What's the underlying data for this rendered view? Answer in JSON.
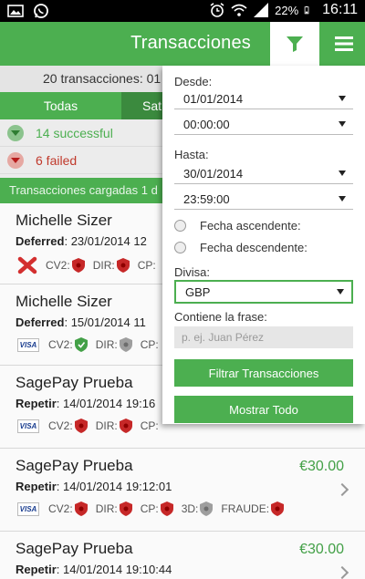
{
  "status_bar": {
    "battery": "22%",
    "time": "16:11"
  },
  "action_bar": {
    "title": "Transacciones"
  },
  "list": {
    "count_text": "20 transacciones: 01",
    "tabs": [
      "Todas",
      "Sat"
    ],
    "successful": "14 successful",
    "failed": "6 failed",
    "loaded_text": "Transacciones cargadas 1 d",
    "transactions": [
      {
        "name": "Michelle Sizer",
        "status": "Deferred",
        "date": "23/01/2014 12",
        "amount": "",
        "card": "redx",
        "checks": [
          {
            "label": "CV2:",
            "state": "fail"
          },
          {
            "label": "DIR:",
            "state": "fail"
          },
          {
            "label": "CP:",
            "state": "fail"
          }
        ]
      },
      {
        "name": "Michelle Sizer",
        "status": "Deferred",
        "date": "15/01/2014 11",
        "amount": "",
        "card": "VISA",
        "checks": [
          {
            "label": "CV2:",
            "state": "pass"
          },
          {
            "label": "DIR:",
            "state": "na"
          },
          {
            "label": "CP:",
            "state": "na"
          }
        ]
      },
      {
        "name": "SagePay Prueba",
        "status": "Repetir",
        "date": "14/01/2014 19:16",
        "amount": "",
        "card": "VISA",
        "checks": [
          {
            "label": "CV2:",
            "state": "fail"
          },
          {
            "label": "DIR:",
            "state": "fail"
          },
          {
            "label": "CP:",
            "state": "fail"
          }
        ]
      },
      {
        "name": "SagePay Prueba",
        "status": "Repetir",
        "date": "14/01/2014 19:12:01",
        "amount": "€30.00",
        "card": "VISA",
        "checks": [
          {
            "label": "CV2:",
            "state": "fail"
          },
          {
            "label": "DIR:",
            "state": "fail"
          },
          {
            "label": "CP:",
            "state": "fail"
          },
          {
            "label": "3D:",
            "state": "na"
          },
          {
            "label": "FRAUDE:",
            "state": "fail"
          }
        ]
      },
      {
        "name": "SagePay Prueba",
        "status": "Repetir",
        "date": "14/01/2014 19:10:44",
        "amount": "€30.00",
        "card": "",
        "checks": []
      }
    ]
  },
  "filter": {
    "from_label": "Desde:",
    "from_date": "01/01/2014",
    "from_time": "00:00:00",
    "to_label": "Hasta:",
    "to_date": "30/01/2014",
    "to_time": "23:59:00",
    "sort_asc": "Fecha ascendente:",
    "sort_desc": "Fecha descendente:",
    "currency_label": "Divisa:",
    "currency": "GBP",
    "phrase_label": "Contiene la frase:",
    "phrase_placeholder": "p. ej. Juan Pérez",
    "filter_button": "Filtrar Transacciones",
    "show_all_button": "Mostrar Todo"
  },
  "colors": {
    "accent": "#4caf50",
    "dark_accent": "#3b8a3e",
    "fail": "#c0392b"
  }
}
